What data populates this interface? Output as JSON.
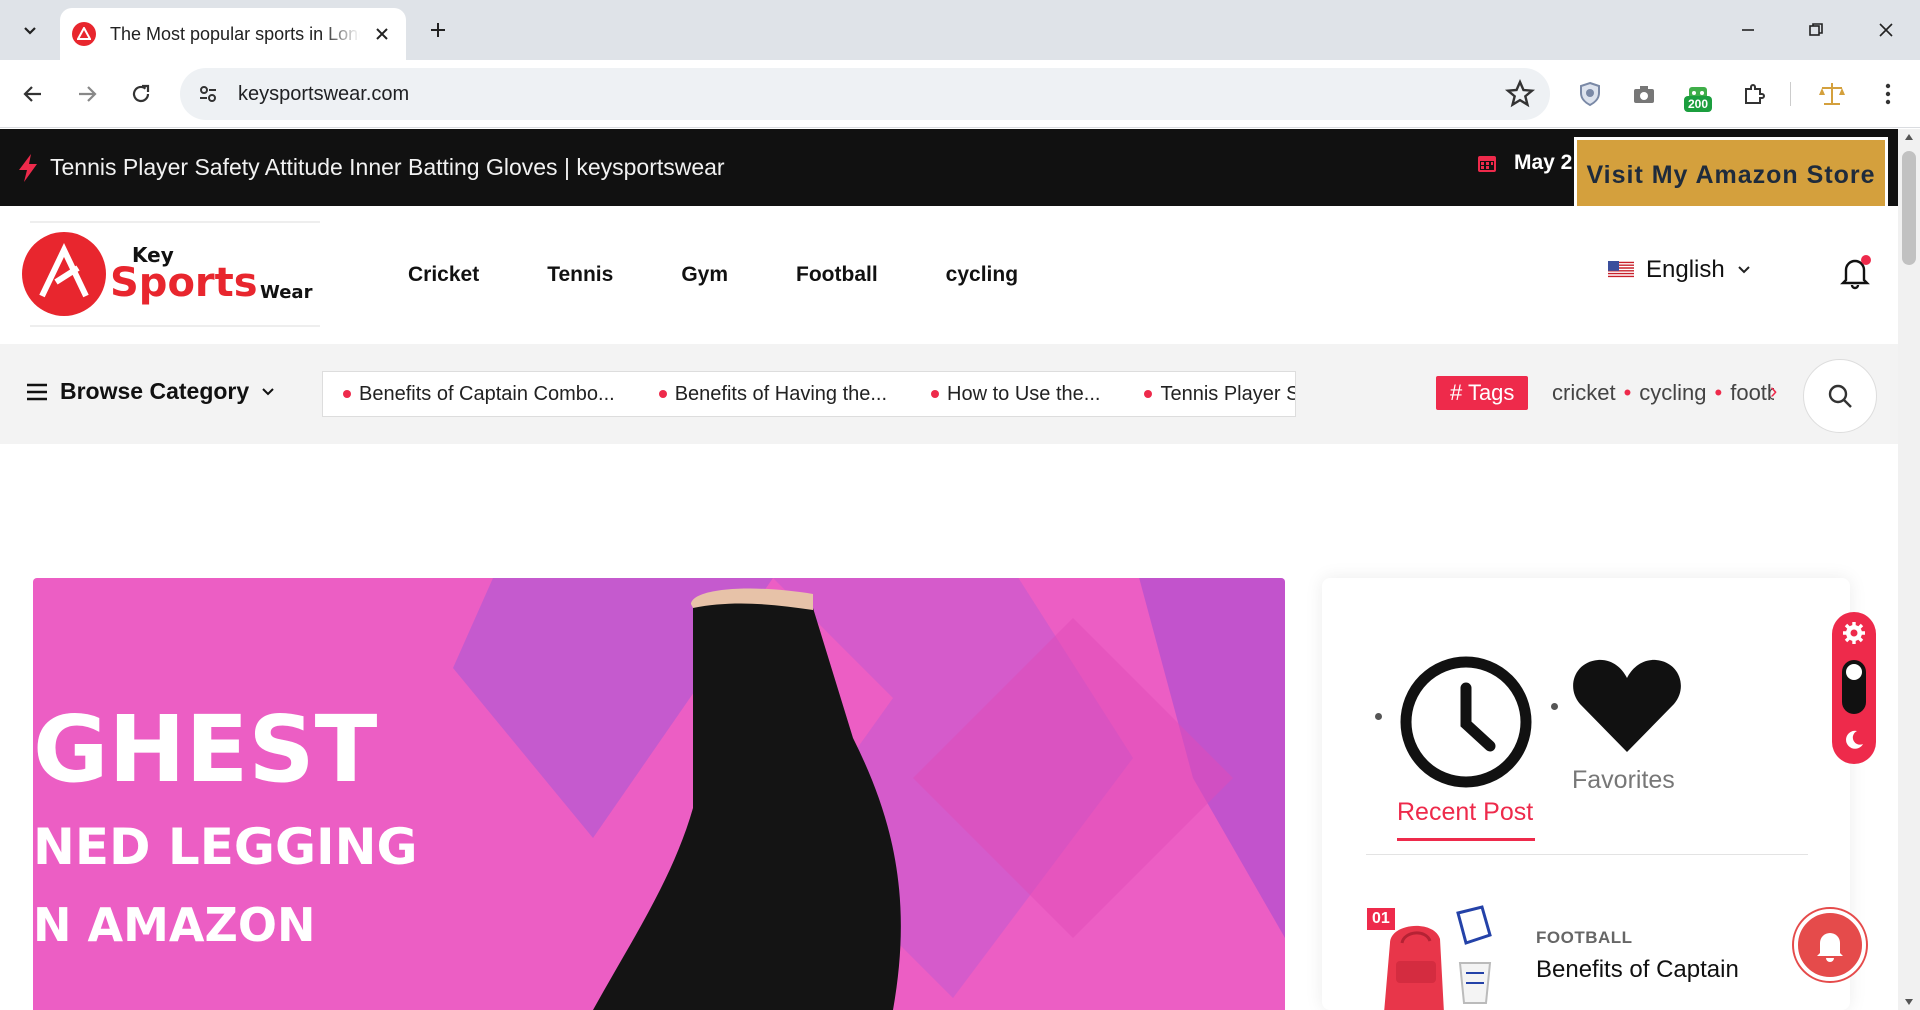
{
  "browser": {
    "tab_title": "The Most popular sports in London",
    "url": "keysportswear.com",
    "extension_badge": "200"
  },
  "topbar": {
    "headline": "Tennis Player Safety Attitude Inner Batting Gloves | keysportswear",
    "date": "May 2",
    "amazon_button": "Visit My Amazon Store"
  },
  "header": {
    "logo": {
      "word1": "Key",
      "word2": "Sports",
      "word3": "Wear"
    },
    "nav": [
      "Cricket",
      "Tennis",
      "Gym",
      "Football",
      "cycling"
    ],
    "language": "English"
  },
  "catbar": {
    "browse_label": "Browse Category",
    "ticker": [
      "Benefits of Captain Combo...",
      "Benefits of Having the...",
      "How to Use the...",
      "Tennis Player Safety"
    ],
    "tags_label": "# Tags",
    "tags": [
      "cricket",
      "cycling",
      "football"
    ],
    "tags_next": "›"
  },
  "hero": {
    "line1": "GHEST",
    "line2": "NED LEGGING",
    "line3": "N AMAZON"
  },
  "sidebar": {
    "recent_label": "Recent Post",
    "favorites_label": "Favorites",
    "post": {
      "number": "01",
      "category": "FOOTBALL",
      "title": "Benefits of Captain"
    }
  },
  "colors": {
    "accent": "#ee2a4b",
    "topbar": "#111111",
    "amazon": "#d4a03d",
    "hero_bg": "#ec5ec4"
  },
  "icons": [
    "chevron-down-icon",
    "close-icon",
    "plus-icon",
    "minimize-icon",
    "restore-icon",
    "back-icon",
    "forward-icon",
    "reload-icon",
    "site-settings-icon",
    "star-icon",
    "shield-icon",
    "camera-icon",
    "puzzle-icon",
    "scale-icon",
    "more-icon",
    "bolt-icon",
    "calendar-icon",
    "flag-icon",
    "bell-icon",
    "menu-icon",
    "search-icon",
    "clock-icon",
    "heart-icon",
    "gear-icon",
    "moon-icon"
  ]
}
